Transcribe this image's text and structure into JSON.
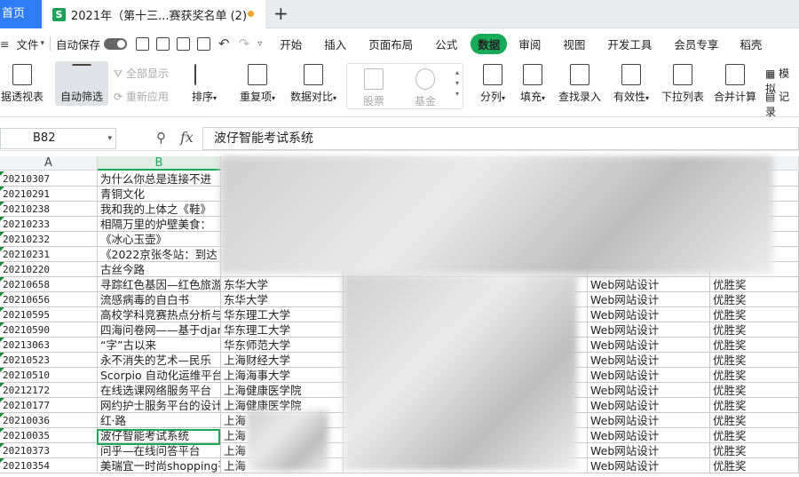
{
  "tabs": {
    "home": "首页",
    "doc_icon": "S",
    "doc_title": "2021年（第十三...赛获奖名单 (2)",
    "add": "+"
  },
  "menu": {
    "file": "文件",
    "autosave": "自动保存",
    "items": [
      "开始",
      "插入",
      "页面布局",
      "公式",
      "数据",
      "审阅",
      "视图",
      "开发工具",
      "会员专享",
      "稻壳"
    ],
    "active": "数据"
  },
  "ribbon": {
    "pivot": "据透视表",
    "autofilter": "自动筛选",
    "show_all": "全部显示",
    "reapply": "重新应用",
    "sort": "排序",
    "duplicates": "重复项",
    "compare": "数据对比",
    "stocks": "股票",
    "funds": "基金",
    "split": "分列",
    "fill": "填充",
    "lookup": "查找录入",
    "validity": "有效性",
    "dropdown": "下拉列表",
    "consolidate": "合并计算",
    "simulate": "模拟",
    "record": "记录"
  },
  "namebox": "B82",
  "formula": "波仔智能考试系统",
  "columns": [
    "A",
    "B"
  ],
  "rows": [
    {
      "id": "20210307",
      "b": "为什么你总是连接不进",
      "c": "",
      "d": ""
    },
    {
      "id": "20210291",
      "b": "青铜文化",
      "c": "",
      "d": ""
    },
    {
      "id": "20210238",
      "b": "我和我的上体之《鞋》",
      "c": "",
      "d": ""
    },
    {
      "id": "20210233",
      "b": "相隔万里的炉壁美食：",
      "c": "",
      "d": ""
    },
    {
      "id": "20210232",
      "b": "《冰心玉壶》",
      "c": "",
      "d": ""
    },
    {
      "id": "20210231",
      "b": "《2022京张冬站：到达",
      "c": "",
      "d": ""
    },
    {
      "id": "20210220",
      "b": "古丝今路",
      "c": "",
      "d": ""
    },
    {
      "id": "20210658",
      "b": "寻踪红色基因—红色旅游",
      "c": "东华大学",
      "d": "Web网站设计",
      "e": "优胜奖"
    },
    {
      "id": "20210656",
      "b": "流感病毒的自白书",
      "c": "东华大学",
      "d": "Web网站设计",
      "e": "优胜奖"
    },
    {
      "id": "20210595",
      "b": "高校学科竞赛热点分析与",
      "c": "华东理工大学",
      "d": "Web网站设计",
      "e": "优胜奖"
    },
    {
      "id": "20210590",
      "b": "四海问卷网——基于djang",
      "c": "华东理工大学",
      "d": "Web网站设计",
      "e": "优胜奖"
    },
    {
      "id": "20213063",
      "b": "“字”古以来",
      "c": "华东师范大学",
      "d": "Web网站设计",
      "e": "优胜奖"
    },
    {
      "id": "20210523",
      "b": "永不消失的艺术—民乐",
      "c": "上海财经大学",
      "d": "Web网站设计",
      "e": "优胜奖"
    },
    {
      "id": "20210510",
      "b": "Scorpio 自动化运维平台",
      "c": "上海海事大学",
      "d": "Web网站设计",
      "e": "优胜奖"
    },
    {
      "id": "20212172",
      "b": "在线选课网络服务平台",
      "c": "上海健康医学院",
      "d": "Web网站设计",
      "e": "优胜奖"
    },
    {
      "id": "20210177",
      "b": "网约护士服务平台的设计",
      "c": "上海健康医学院",
      "d": "Web网站设计",
      "e": "优胜奖"
    },
    {
      "id": "20210036",
      "b": "红·路",
      "c": "上海",
      "d": "Web网站设计",
      "e": "优胜奖"
    },
    {
      "id": "20210035",
      "b": "波仔智能考试系统",
      "c": "上海",
      "d": "Web网站设计",
      "e": "优胜奖"
    },
    {
      "id": "20210373",
      "b": "问乎—在线问答平台",
      "c": "上海",
      "d": "Web网站设计",
      "e": "优胜奖"
    },
    {
      "id": "20210354",
      "b": "美瑞宜一时尚shopping平台",
      "c": "上海",
      "d": "Web网站设计",
      "e": "优胜奖"
    }
  ]
}
